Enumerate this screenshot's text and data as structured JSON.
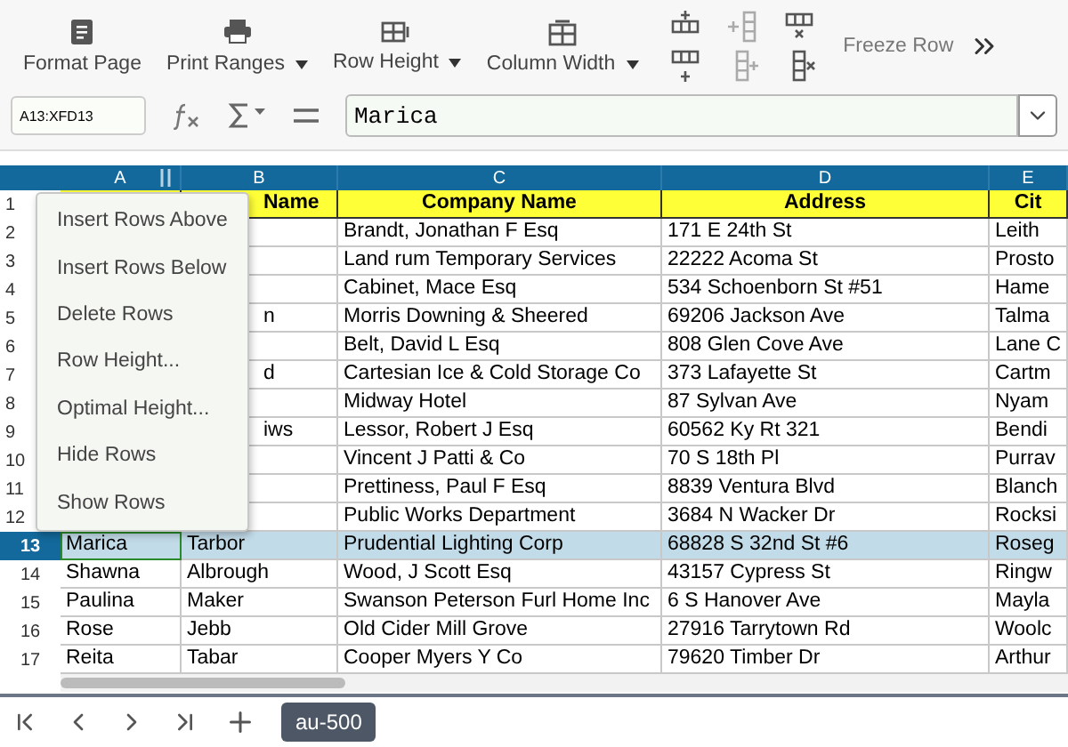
{
  "toolbar": {
    "items": [
      {
        "label": "Format Page",
        "kind": "page",
        "dropdown": false
      },
      {
        "label": "Print Ranges",
        "kind": "printer",
        "dropdown": true
      },
      {
        "label": "Row Height",
        "kind": "row-table",
        "dropdown": true
      },
      {
        "label": "Column Width",
        "kind": "col-table",
        "dropdown": true
      }
    ],
    "small_tools": [
      {
        "kind": "insert-row-above",
        "disabled": false
      },
      {
        "kind": "insert-col-before",
        "disabled": true
      },
      {
        "kind": "delete-row",
        "disabled": false
      },
      {
        "kind": "insert-row-below",
        "disabled": false
      },
      {
        "kind": "insert-col-after",
        "disabled": true
      },
      {
        "kind": "delete-col",
        "disabled": false
      }
    ],
    "trailing_label": "Freeze Row"
  },
  "formula_bar": {
    "name_box": "A13:XFD13",
    "value": "Marica"
  },
  "columns": [
    {
      "letter": "A",
      "freeze_handle": true
    },
    {
      "letter": "B",
      "freeze_handle": false
    },
    {
      "letter": "C",
      "freeze_handle": false
    },
    {
      "letter": "D",
      "freeze_handle": false
    },
    {
      "letter": "E",
      "freeze_handle": false
    }
  ],
  "rows": [
    {
      "number": "1",
      "kind": "header",
      "selected": false,
      "cells": [
        "",
        "Name",
        "Company Name",
        "Address",
        "Cit"
      ]
    },
    {
      "number": "2",
      "kind": "data",
      "selected": false,
      "cells": [
        "",
        "",
        "Brandt, Jonathan F Esq",
        "171 E 24th St",
        "Leith"
      ]
    },
    {
      "number": "3",
      "kind": "data",
      "selected": false,
      "cells": [
        "",
        "",
        "Land rum Temporary Services",
        "22222 Acoma St",
        "Prosto"
      ]
    },
    {
      "number": "4",
      "kind": "data",
      "selected": false,
      "cells": [
        "",
        "",
        "Cabinet, Mace Esq",
        "534 Schoenborn St #51",
        "Hame"
      ]
    },
    {
      "number": "5",
      "kind": "data",
      "selected": false,
      "cells": [
        "",
        "n",
        "Morris Downing & Sheered",
        "69206 Jackson Ave",
        "Talma"
      ]
    },
    {
      "number": "6",
      "kind": "data",
      "selected": false,
      "cells": [
        "",
        "",
        "Belt, David L Esq",
        "808 Glen Cove Ave",
        "Lane C"
      ]
    },
    {
      "number": "7",
      "kind": "data",
      "selected": false,
      "cells": [
        "",
        "d",
        "Cartesian Ice & Cold Storage Co",
        "373 Lafayette St",
        "Cartm"
      ]
    },
    {
      "number": "8",
      "kind": "data",
      "selected": false,
      "cells": [
        "",
        "",
        "Midway Hotel",
        "87 Sylvan Ave",
        "Nyam"
      ]
    },
    {
      "number": "9",
      "kind": "data",
      "selected": false,
      "cells": [
        "",
        "iws",
        "Lessor, Robert J Esq",
        "60562 Ky Rt 321",
        "Bendi"
      ]
    },
    {
      "number": "10",
      "kind": "data",
      "selected": false,
      "cells": [
        "",
        "",
        "Vincent J Patti & Co",
        "70 S 18th Pl",
        "Purrav"
      ]
    },
    {
      "number": "11",
      "kind": "data",
      "selected": false,
      "cells": [
        "",
        "",
        "Prettiness, Paul F Esq",
        "8839 Ventura Blvd",
        "Blanch"
      ]
    },
    {
      "number": "12",
      "kind": "data",
      "selected": false,
      "cells": [
        "",
        "",
        "Public Works Department",
        "3684 N Wacker Dr",
        "Rocksi"
      ]
    },
    {
      "number": "13",
      "kind": "data",
      "selected": true,
      "cells": [
        "Marica",
        "Tarbor",
        "Prudential Lighting Corp",
        "68828 S 32nd St #6",
        "Roseg"
      ]
    },
    {
      "number": "14",
      "kind": "data",
      "selected": false,
      "cells": [
        "Shawna",
        "Albrough",
        "Wood, J Scott Esq",
        "43157 Cypress St",
        "Ringw"
      ]
    },
    {
      "number": "15",
      "kind": "data",
      "selected": false,
      "cells": [
        "Paulina",
        "Maker",
        "Swanson Peterson Furl Home Inc",
        "6 S Hanover Ave",
        "Mayla"
      ]
    },
    {
      "number": "16",
      "kind": "data",
      "selected": false,
      "cells": [
        "Rose",
        "Jebb",
        "Old Cider Mill Grove",
        "27916 Tarrytown Rd",
        "Woolc"
      ]
    },
    {
      "number": "17",
      "kind": "data",
      "selected": false,
      "cells": [
        "Reita",
        "Tabar",
        "Cooper Myers Y Co",
        "79620 Timber Dr",
        "Arthur"
      ]
    }
  ],
  "context_menu": {
    "items": [
      "Insert Rows Above",
      "Insert Rows Below",
      "Delete Rows",
      "Row Height...",
      "Optimal Height...",
      "Hide Rows",
      "Show Rows"
    ]
  },
  "sheet_tabs": [
    {
      "label": "au-500",
      "selected": true
    }
  ]
}
